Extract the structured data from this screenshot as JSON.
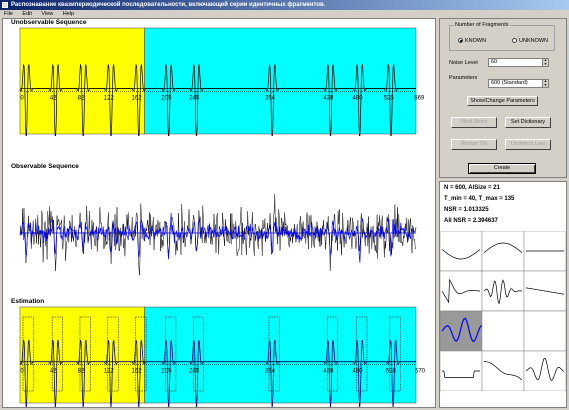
{
  "window": {
    "title": "Распознавание квазипериодической последовательности, включающей серии идентичных фрагментов."
  },
  "menu": [
    "File",
    "Edit",
    "View",
    "Help"
  ],
  "plots": {
    "unobservable": {
      "title": "Unobservable Sequence",
      "ticks": [
        "0",
        "42",
        "82",
        "122",
        "162",
        "205",
        "245",
        "354",
        "438",
        "480",
        "525",
        "569"
      ]
    },
    "observable": {
      "title": "Observable Sequence"
    },
    "estimation": {
      "title": "Estimation",
      "ticks": [
        "0",
        "42",
        "82",
        "122",
        "162",
        "205",
        "245",
        "354",
        "438",
        "480",
        "528",
        "570"
      ]
    }
  },
  "colors": {
    "yellow_region": "#ffff00",
    "cyan_region": "#00ffff",
    "estimate_line": "#0000ff",
    "selected_tile": "#999999"
  },
  "controls": {
    "fragments_group": "Number of Fragments",
    "known": "KNOWN",
    "unknown": "UNKNOWN",
    "noise_label": "Noise Level",
    "noise_value": "60",
    "params_label": "Parameters",
    "params_value": "600 (Standard)",
    "show_change": "Show/Change Parameters",
    "next_word": "Next Word",
    "set_dictionary": "Set Dictionary",
    "restart": "Restart Do",
    "undefect": "Undefect Last",
    "create": "Create"
  },
  "info": {
    "line1": "N = 600, AlSize = 21",
    "line2": "T_min = 40,  T_max = 135",
    "line3": "NSR = 1.013325",
    "line4": "All NSR = 2.394637"
  },
  "dictionary": {
    "tiles": [
      "arch-up",
      "arch-down",
      "tile-empty",
      "decay-wave",
      "burst-wave",
      "ramp-down",
      "selected-wavelet",
      "tile-empty-2",
      "tile-empty-3",
      "step-pulse",
      "ramp-wave",
      "spike-wave"
    ],
    "selected_index": 6
  }
}
